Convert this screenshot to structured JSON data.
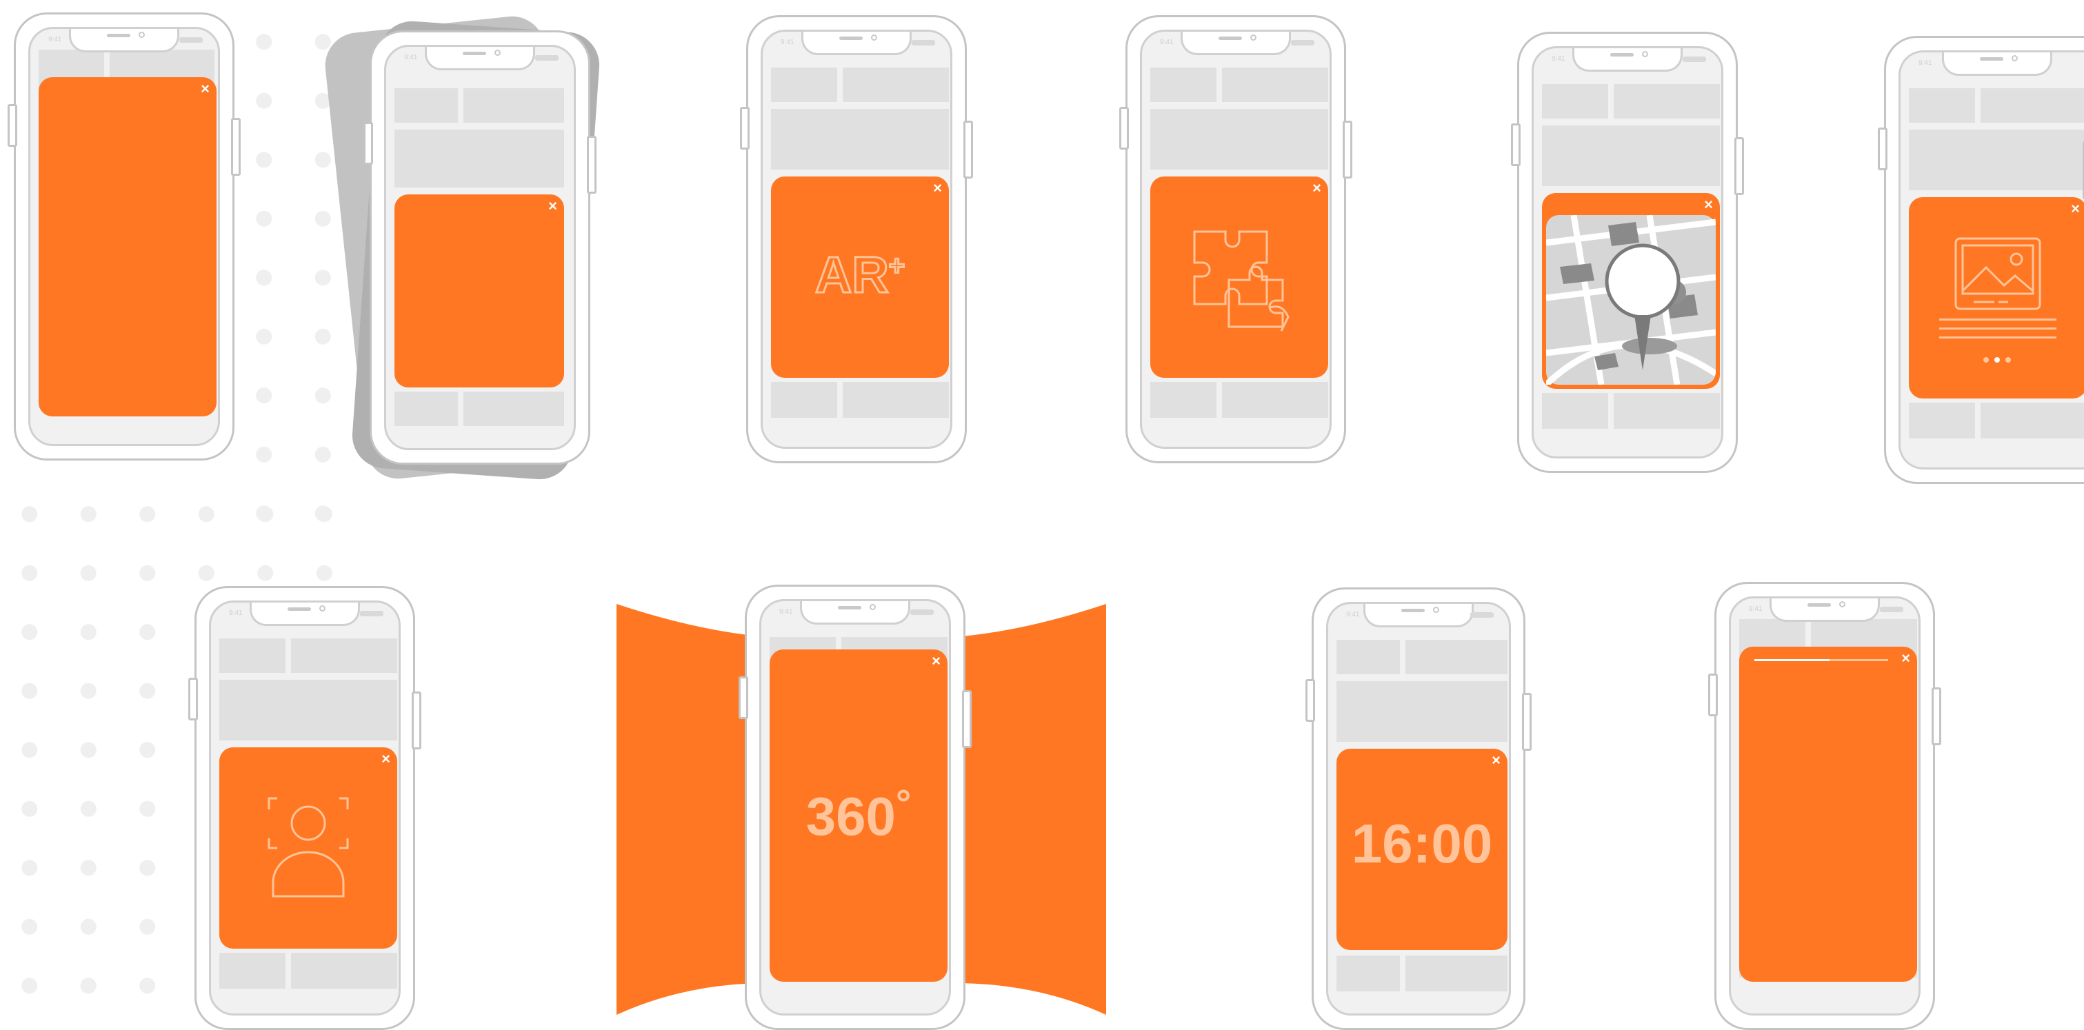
{
  "status_time": "9:41",
  "close_glyph": "×",
  "colors": {
    "accent": "#ff7722",
    "placeholder": "#e0e0e0",
    "outline": "#c4c4c4"
  },
  "phones": [
    {
      "id": "fullscreen",
      "icon": ""
    },
    {
      "id": "stack",
      "icon": ""
    },
    {
      "id": "ar",
      "icon": "ar-icon",
      "label": "AR",
      "sup": "+"
    },
    {
      "id": "puzzle",
      "icon": "puzzle-icon"
    },
    {
      "id": "map",
      "icon": "map-pin-icon"
    },
    {
      "id": "gallery",
      "icon": "image-icon"
    },
    {
      "id": "face",
      "icon": "face-scan-icon"
    },
    {
      "id": "panorama",
      "icon": "panorama-icon",
      "label": "360",
      "sup": "°"
    },
    {
      "id": "countdown",
      "icon": "",
      "label": "16:00"
    },
    {
      "id": "story",
      "icon": ""
    }
  ]
}
